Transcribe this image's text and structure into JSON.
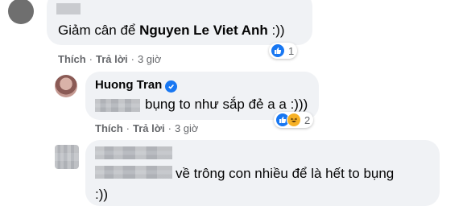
{
  "comments": [
    {
      "author": "",
      "text_prefix": "Giảm cân để ",
      "text_mention": "Nguyen Le Viet Anh",
      "text_suffix": " :))",
      "like_label": "Thích",
      "reply_label": "Trả lời",
      "time": "3 giờ",
      "reaction_count": "1",
      "reactions": [
        "like"
      ]
    },
    {
      "author": "Huong Tran",
      "verified": true,
      "text": "bụng to như sắp đẻ a a :)))",
      "like_label": "Thích",
      "reply_label": "Trả lời",
      "time": "3 giờ",
      "reaction_count": "2",
      "reactions": [
        "like",
        "haha"
      ]
    },
    {
      "author": "",
      "text_line1": "về trông con nhiều để là hết to bụng",
      "text_line2": ":))"
    }
  ],
  "colors": {
    "bubble": "#f0f2f5",
    "link": "#65676b",
    "like": "#1877f2",
    "haha": "#f7b125"
  }
}
